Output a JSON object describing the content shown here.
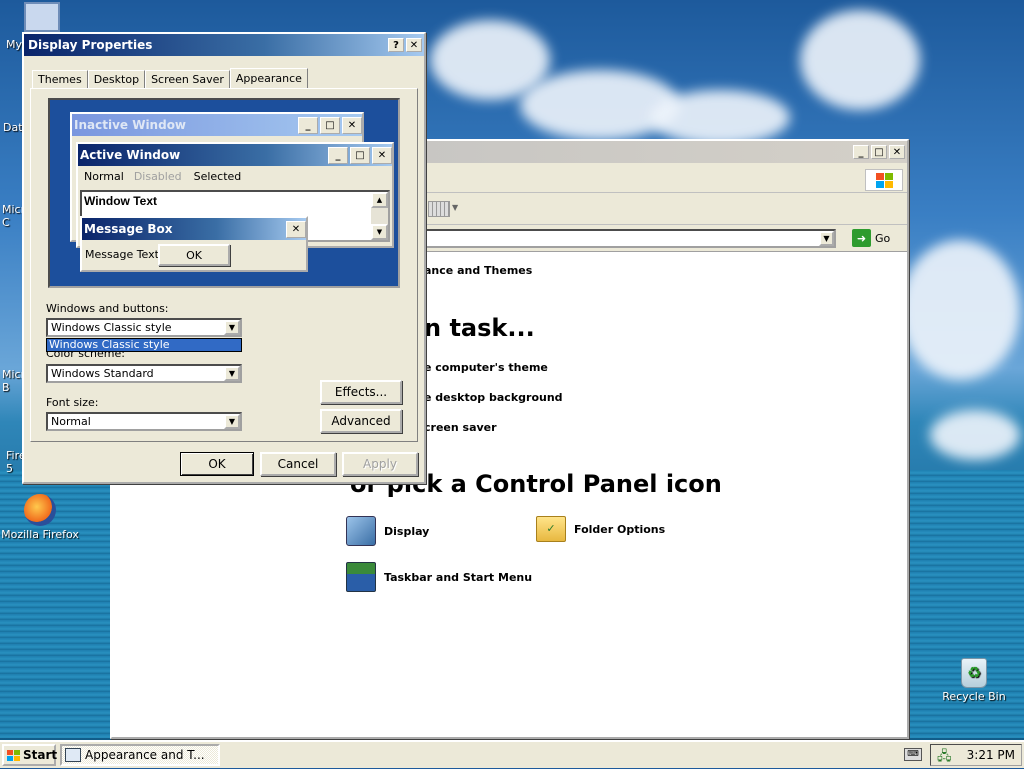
{
  "desktop": {
    "icons": [
      {
        "label": "My"
      },
      {
        "label": "Dat"
      },
      {
        "label": "Micr\nC"
      },
      {
        "label": "Micr\nB"
      },
      {
        "label": "Fire\n5"
      },
      {
        "label": "Mozilla Firefox"
      },
      {
        "label": "Recycle Bin"
      }
    ]
  },
  "explorer": {
    "go_label": "Go",
    "category_title": "ance and Themes",
    "pick_task_heading": "n task...",
    "tasks": [
      "e computer's theme",
      "e desktop background",
      "creen saver"
    ],
    "pick_icon_heading": "or pick a Control Panel icon",
    "icons": [
      "Display",
      "Folder Options",
      "Taskbar and Start Menu"
    ]
  },
  "dialog": {
    "title": "Display Properties",
    "help_btn": "?",
    "close_btn": "✕",
    "tabs": [
      "Themes",
      "Desktop",
      "Screen Saver",
      "Appearance"
    ],
    "preview": {
      "inactive_title": "Inactive Window",
      "active_title": "Active Window",
      "menu_normal": "Normal",
      "menu_disabled": "Disabled",
      "menu_selected": "Selected",
      "window_text": "Window Text",
      "msgbox_title": "Message Box",
      "msgbox_text": "Message Text",
      "msgbox_ok": "OK"
    },
    "windows_buttons_label": "Windows and buttons:",
    "windows_buttons_value": "Windows Classic style",
    "windows_buttons_dropdown_option": "Windows Classic style",
    "color_scheme_label": "Color scheme:",
    "color_scheme_value": "Windows Standard",
    "font_size_label": "Font size:",
    "font_size_value": "Normal",
    "effects_btn": "Effects...",
    "advanced_btn": "Advanced",
    "ok_btn": "OK",
    "cancel_btn": "Cancel",
    "apply_btn": "Apply"
  },
  "taskbar": {
    "start_label": "Start",
    "task_label": "Appearance and T...",
    "clock": "3:21 PM"
  },
  "colors": {
    "active_title": "#0a246a",
    "selection": "#316ac5",
    "preview_bg": "#1c4f9c"
  }
}
